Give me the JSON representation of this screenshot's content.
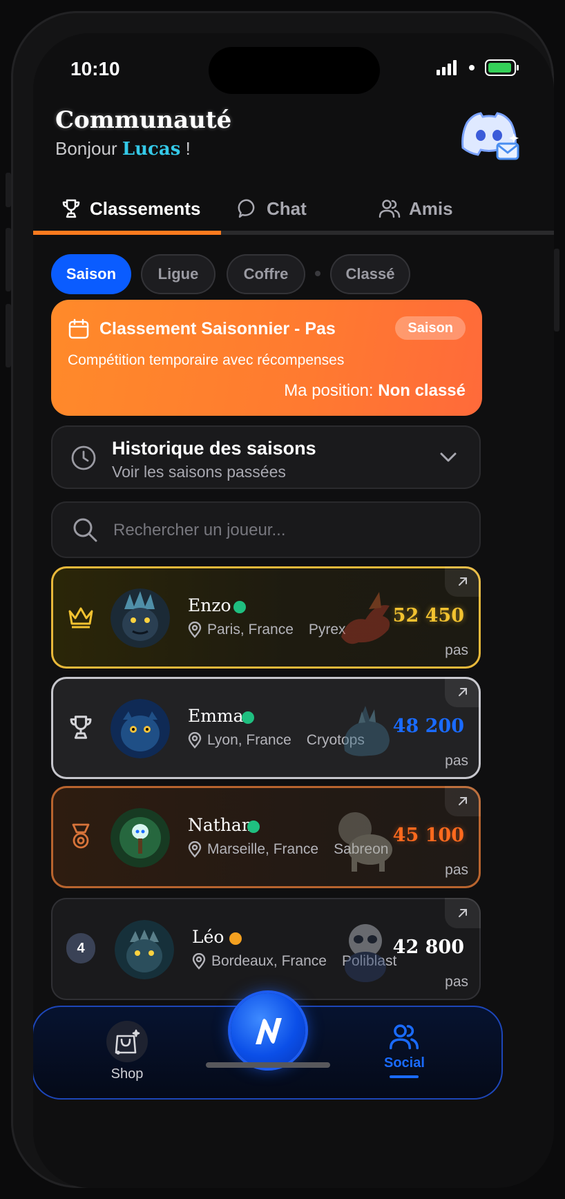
{
  "status_bar": {
    "time": "10:10"
  },
  "header": {
    "title": "Communauté",
    "greeting_prefix": "Bonjour ",
    "user_name": "Lucas",
    "greeting_suffix": " !"
  },
  "tabs": [
    {
      "label": "Classements",
      "icon": "trophy-icon",
      "active": true
    },
    {
      "label": "Chat",
      "icon": "chat-bubble-icon",
      "active": false
    },
    {
      "label": "Amis",
      "icon": "users-icon",
      "active": false
    }
  ],
  "filters": [
    {
      "label": "Saison",
      "active": true
    },
    {
      "label": "Ligue",
      "active": false
    },
    {
      "label": "Coffre",
      "active": false
    },
    {
      "label": "Classé",
      "active": false
    }
  ],
  "season_card": {
    "title": "Classement Saisonnier - Pas",
    "badge": "Saison",
    "description": "Compétition temporaire avec récompenses",
    "position_label": "Ma position: ",
    "position_value": "Non classé"
  },
  "history": {
    "title": "Historique des saisons",
    "subtitle": "Voir les saisons passées"
  },
  "search": {
    "placeholder": "Rechercher un joueur..."
  },
  "players": [
    {
      "rank": 1,
      "rank_icon": "crown-icon",
      "name": "Enzo",
      "status": "online",
      "location": "Paris, France",
      "monster": "Pyrex",
      "score": "52 450",
      "unit": "pas"
    },
    {
      "rank": 2,
      "rank_icon": "trophy-icon",
      "name": "Emma",
      "status": "online",
      "location": "Lyon, France",
      "monster": "Cryotops",
      "score": "48 200",
      "unit": "pas"
    },
    {
      "rank": 3,
      "rank_icon": "medal-icon",
      "name": "Nathan",
      "status": "online",
      "location": "Marseille, France",
      "monster": "Sabreon",
      "score": "45 100",
      "unit": "pas"
    },
    {
      "rank": 4,
      "rank_label": "4",
      "name": "Léo",
      "status": "away",
      "location": "Bordeaux, France",
      "monster": "Poliblast",
      "score": "42 800",
      "unit": "pas"
    }
  ],
  "bottom_nav": [
    {
      "label": "Shop",
      "icon": "shopping-bag-icon",
      "active": false
    },
    {
      "label": "",
      "icon": "app-logo-icon",
      "active": false
    },
    {
      "label": "Social",
      "icon": "users-icon",
      "active": true
    }
  ],
  "colors": {
    "accent_orange": "#ff7a1e",
    "accent_blue": "#0a5cff",
    "gold": "#f2c230",
    "silver": "#c9c9cf",
    "bronze": "#d8743a",
    "online": "#1fbf80",
    "away": "#f3a020",
    "name_highlight": "#34c9e8"
  }
}
